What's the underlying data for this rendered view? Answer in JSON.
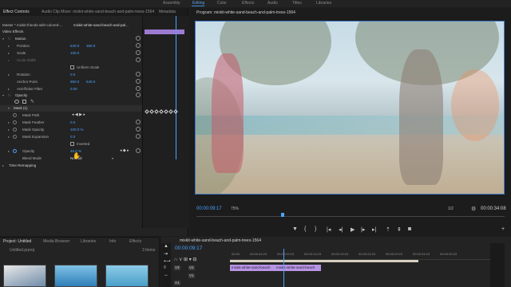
{
  "topbar": {
    "workspaces": [
      "Assembly",
      "Editing",
      "Color",
      "Effects",
      "Audio",
      "Titles",
      "Libraries"
    ],
    "active": "Editing"
  },
  "effect_controls": {
    "tabs": [
      "Effect Controls",
      "Audio Clip Mixer: mixkit-white-sand-beach-and-palm-trees-1564",
      "Metadata"
    ],
    "master": "Master * mixkit-friends-with-colored-...",
    "clip": "mixkit-white-sand-beach-and-pal...",
    "section": "Video Effects",
    "motion": "Motion",
    "position": {
      "label": "Position",
      "x": "640.0",
      "y": "360.0"
    },
    "scale": {
      "label": "Scale",
      "value": "100.0"
    },
    "scale_width": {
      "label": "Scale Width"
    },
    "uniform": "Uniform Scale",
    "rotation": {
      "label": "Rotation",
      "value": "0.0"
    },
    "anchor": {
      "label": "Anchor Point",
      "x": "960.0",
      "y": "640.0"
    },
    "antiflicker": {
      "label": "Anti-flicker Filter",
      "value": "0.00"
    },
    "opacity_group": "Opacity",
    "mask": "Mask (1)",
    "mask_path": "Mask Path",
    "mask_feather": {
      "label": "Mask Feather",
      "value": "0.0"
    },
    "mask_opacity": {
      "label": "Mask Opacity",
      "value": "100.0 %"
    },
    "mask_expansion": {
      "label": "Mask Expansion",
      "value": "0.0"
    },
    "inverted": "Inverted",
    "opacity": {
      "label": "Opacity",
      "value": "46.0 %"
    },
    "blend": {
      "label": "Blend Mode",
      "value": "Normal"
    },
    "time_remap": "Time Remapping"
  },
  "program": {
    "title": "Program: mixkit-white-sand-beach-and-palm-trees-1564",
    "timecode": "00:00:09:17",
    "fit": "75%",
    "quality": "1/2",
    "duration": "00:00:34:08"
  },
  "project": {
    "tabs": [
      "Project: Untitled",
      "Media Browser",
      "Libraries",
      "Info",
      "Effects"
    ],
    "file": "Untitled.prproj",
    "items": "3 Items"
  },
  "timeline": {
    "title": "mixkit-white-sand-beach-and-palm-trees-1564",
    "timecode": "00:00:09:17",
    "ruler": [
      "00:00",
      "00:00:04:23",
      "00:00:09:23",
      "00:00:14:23",
      "00:00:19:23",
      "00:00:24:23",
      "00:00:29:23",
      "00:00:34:23",
      "00:00:39:23"
    ],
    "clip1": "mixkit-white-sand-beach",
    "clip2": "mixkit-white-sand-beach",
    "tracks": [
      "V3",
      "V2",
      "V1",
      "A1"
    ]
  },
  "colors": {
    "accent": "#4aa3ff",
    "clip": "#b794e3",
    "keyframe_bar": "#9d7ad2"
  }
}
